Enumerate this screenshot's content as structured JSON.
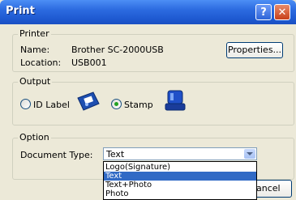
{
  "window": {
    "title": "Print",
    "help_glyph": "?",
    "close_glyph": "✕"
  },
  "printer": {
    "legend": "Printer",
    "name_label": "Name:",
    "name_value": "Brother SC-2000USB",
    "location_label": "Location:",
    "location_value": "USB001",
    "properties_label": "Properties..."
  },
  "output": {
    "legend": "Output",
    "options": [
      {
        "label": "ID Label",
        "selected": false,
        "icon": "id-card-icon"
      },
      {
        "label": "Stamp",
        "selected": true,
        "icon": "stamp-icon"
      }
    ]
  },
  "option": {
    "legend": "Option",
    "document_type_label": "Document Type:",
    "document_type_value": "Text",
    "dropdown_items": [
      {
        "label": "Logo(Signature)",
        "selected": false
      },
      {
        "label": "Text",
        "selected": true
      },
      {
        "label": "Text+Photo",
        "selected": false
      },
      {
        "label": "Photo",
        "selected": false
      }
    ]
  },
  "footer": {
    "cancel_label": "Cancel",
    "cancel_partial": "ancel"
  },
  "colors": {
    "title_bar": "#1D58D0",
    "dialog_bg": "#ECE9D8",
    "selection": "#316AC5"
  }
}
